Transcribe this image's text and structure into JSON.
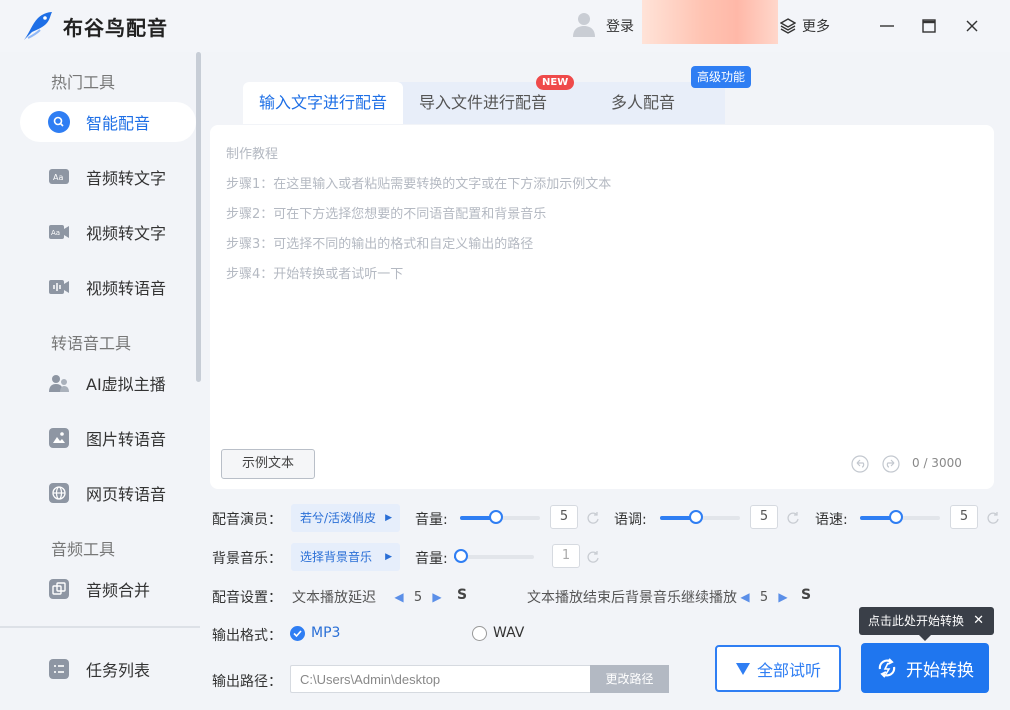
{
  "app": {
    "title": "布谷鸟配音",
    "login_label": "登录",
    "more_label": "更多"
  },
  "sidebar": {
    "sections": [
      {
        "heading": "热门工具"
      },
      {
        "heading": "转语音工具"
      },
      {
        "heading": "音频工具"
      }
    ],
    "items": [
      {
        "label": "智能配音",
        "icon": "smart-dub-icon",
        "active": true
      },
      {
        "label": "音频转文字",
        "icon": "audio-text-icon"
      },
      {
        "label": "视频转文字",
        "icon": "video-text-icon"
      },
      {
        "label": "视频转语音",
        "icon": "video-voice-icon"
      },
      {
        "label": "AI虚拟主播",
        "icon": "ai-anchor-icon"
      },
      {
        "label": "图片转语音",
        "icon": "image-voice-icon"
      },
      {
        "label": "网页转语音",
        "icon": "web-voice-icon"
      },
      {
        "label": "音频合并",
        "icon": "audio-merge-icon"
      },
      {
        "label": "任务列表",
        "icon": "task-list-icon"
      }
    ]
  },
  "tabs": [
    {
      "label": "输入文字进行配音",
      "active": true
    },
    {
      "label": "导入文件进行配音",
      "badge": "NEW"
    },
    {
      "label": "多人配音",
      "badge": "高级功能"
    }
  ],
  "editor": {
    "guide": [
      "制作教程",
      "步骤1：在这里输入或者粘贴需要转换的文字或在下方添加示例文本",
      "步骤2：可在下方选择您想要的不同语音配置和背景音乐",
      "步骤3：可选择不同的输出的格式和自定义输出的路径",
      "步骤4：开始转换或者试听一下"
    ],
    "sample_button": "示例文本",
    "char_count": "0 / 3000"
  },
  "voice": {
    "label": "配音演员：",
    "actor": "若兮/活泼俏皮",
    "volume_label": "音量:",
    "volume": "5",
    "volume_level": 0.44,
    "pitch_label": "语调:",
    "pitch": "5",
    "pitch_level": 0.44,
    "speed_label": "语速:",
    "speed": "5",
    "speed_level": 0.44
  },
  "bgm": {
    "label": "背景音乐：",
    "selector": "选择背景音乐",
    "volume_label": "音量:",
    "volume": "1",
    "volume_level": 0.0
  },
  "settings": {
    "label": "配音设置：",
    "delay_label": "文本播放延迟",
    "delay": "5",
    "delay_unit": "S",
    "continue_label": "文本播放结束后背景音乐继续播放",
    "continue": "5",
    "continue_unit": "S"
  },
  "output": {
    "format_label": "输出格式：",
    "formats": [
      {
        "label": "MP3",
        "checked": true
      },
      {
        "label": "WAV",
        "checked": false
      }
    ],
    "path_label": "输出路径：",
    "path": "C:\\Users\\Admin\\desktop",
    "change_path": "更改路径"
  },
  "actions": {
    "listen_all": "全部试听",
    "start": "开始转换",
    "tooltip": "点击此处开始转换"
  },
  "colors": {
    "accent": "#1f76ef",
    "active_text": "#1e6fe6",
    "new_badge": "#ef4a4a"
  }
}
